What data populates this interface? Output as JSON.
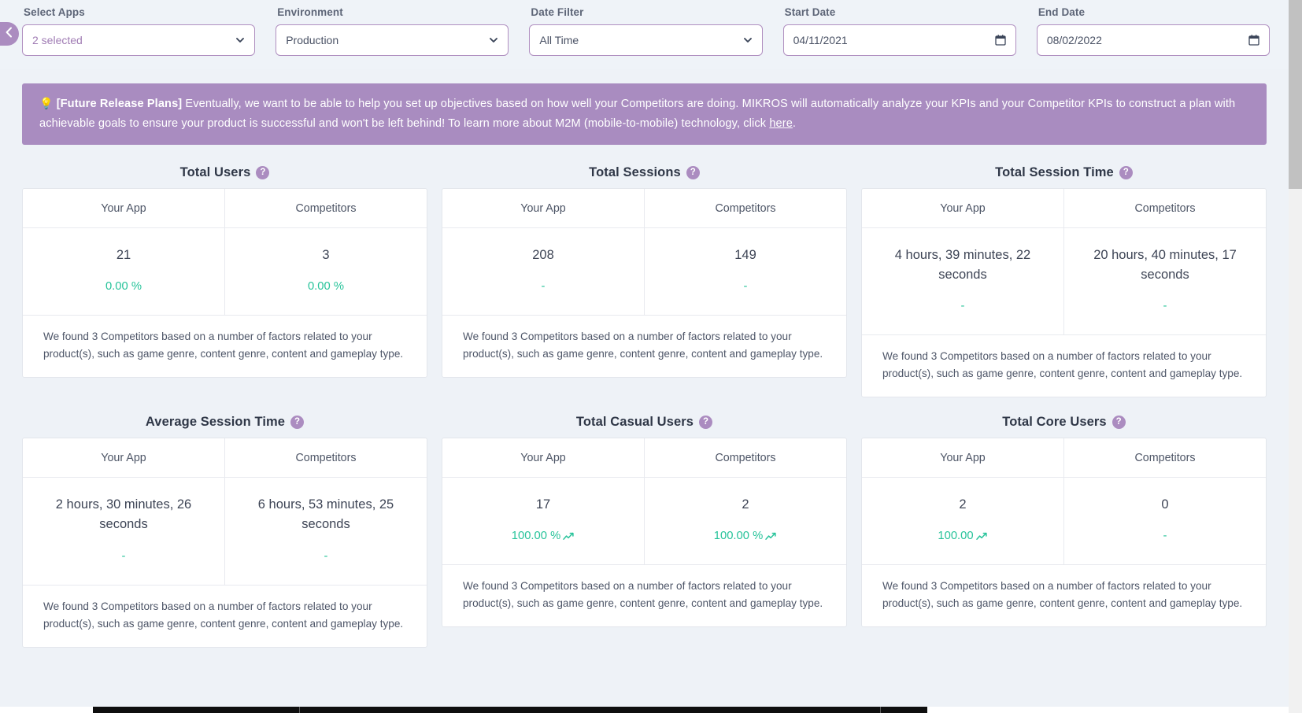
{
  "filters": [
    {
      "label": "Select Apps",
      "value": "2 selected",
      "type": "select",
      "purple": true,
      "icon": "chevron-down-icon",
      "name": "select-apps"
    },
    {
      "label": "Environment",
      "value": "Production",
      "type": "select",
      "purple": false,
      "icon": "chevron-down-icon",
      "name": "environment"
    },
    {
      "label": "Date Filter",
      "value": "All Time",
      "type": "select",
      "purple": false,
      "icon": "chevron-down-icon",
      "name": "date-filter"
    },
    {
      "label": "Start Date",
      "value": "04/11/2021",
      "type": "date",
      "purple": false,
      "icon": "calendar-icon",
      "name": "start-date"
    },
    {
      "label": "End Date",
      "value": "08/02/2022",
      "type": "date",
      "purple": false,
      "icon": "calendar-icon",
      "name": "end-date"
    }
  ],
  "banner": {
    "bulb": "💡",
    "tag": "[Future Release Plans]",
    "text_1": " Eventually, we want to be able to help you set up objectives based on how well your Competitors are doing. MIKROS will automatically analyze your KPIs and your Competitor KPIs to construct a plan with achievable goals to ensure your product is successful and won't be left behind! To learn more about M2M (mobile-to-mobile) technology, click ",
    "link": "here",
    "text_2": "."
  },
  "columns": {
    "your_app": "Your App",
    "competitors": "Competitors"
  },
  "footnote": "We found 3 Competitors based on a number of factors related to your product(s), such as game genre, content genre, content and gameplay type.",
  "help_glyph": "?",
  "colors": {
    "accent_purple": "#a98cc0",
    "border_purple": "#b08fc0",
    "positive_green": "#27c39a",
    "page_bg": "#eef2f7",
    "card_bg": "#ffffff"
  },
  "metrics": [
    {
      "title": "Total Users",
      "your_app": {
        "value": "21",
        "delta": "0.00 %",
        "trend": "none"
      },
      "competitors": {
        "value": "3",
        "delta": "0.00 %",
        "trend": "none"
      }
    },
    {
      "title": "Total Sessions",
      "your_app": {
        "value": "208",
        "delta": "-",
        "trend": "none"
      },
      "competitors": {
        "value": "149",
        "delta": "-",
        "trend": "none"
      }
    },
    {
      "title": "Total Session Time",
      "your_app": {
        "value": "4 hours, 39 minutes, 22 seconds",
        "delta": "-",
        "trend": "none"
      },
      "competitors": {
        "value": "20 hours, 40 minutes, 17 seconds",
        "delta": "-",
        "trend": "none"
      }
    },
    {
      "title": "Average Session Time",
      "your_app": {
        "value": "2 hours, 30 minutes, 26 seconds",
        "delta": "-",
        "trend": "none"
      },
      "competitors": {
        "value": "6 hours, 53 minutes, 25 seconds",
        "delta": "-",
        "trend": "none"
      }
    },
    {
      "title": "Total Casual Users",
      "your_app": {
        "value": "17",
        "delta": "100.00 %",
        "trend": "up"
      },
      "competitors": {
        "value": "2",
        "delta": "100.00 %",
        "trend": "up"
      }
    },
    {
      "title": "Total Core Users",
      "your_app": {
        "value": "2",
        "delta": "100.00",
        "trend": "up"
      },
      "competitors": {
        "value": "0",
        "delta": "-",
        "trend": "none"
      }
    }
  ],
  "sidebar_toggle": {
    "icon": "chevron-left-icon"
  }
}
